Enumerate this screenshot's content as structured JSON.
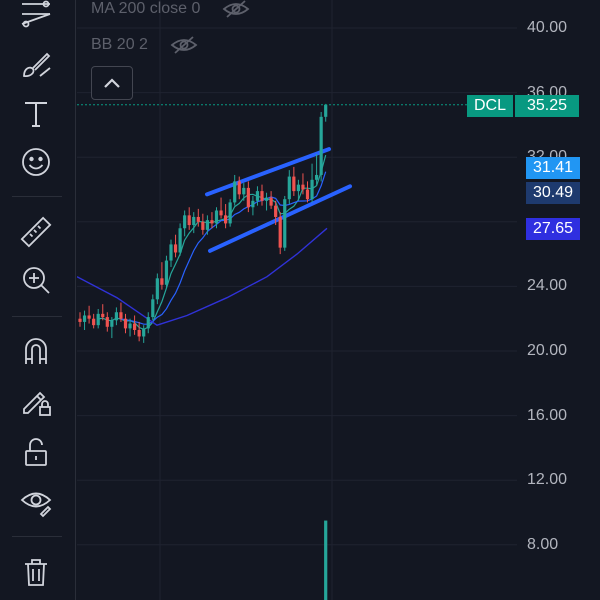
{
  "indicators": [
    {
      "label": "MA 200 close 0",
      "icon": "eye-crossed-icon"
    },
    {
      "label": "BB 20 2",
      "icon": "eye-crossed-icon"
    }
  ],
  "toolbar": {
    "tools": [
      "trend-line-icon",
      "brush-icon",
      "text-icon",
      "emoji-icon",
      "ruler-icon",
      "zoom-in-icon",
      "magnet-icon",
      "lock-drawing-icon",
      "unlock-icon",
      "eye-visibility-icon",
      "trash-icon"
    ]
  },
  "price_axis": {
    "ticks": [
      "40.00",
      "36.00",
      "32.00",
      "24.00",
      "20.00",
      "16.00",
      "12.00",
      "8.00"
    ]
  },
  "price_tags": {
    "symbol": "DCL",
    "last": "35.25",
    "tag1": "31.41",
    "tag2": "30.49",
    "tag3": "27.65"
  },
  "colors": {
    "background": "#131722",
    "up": "#26a69a",
    "down": "#ef5350",
    "channel": "#2962ff",
    "ma": "#3032d8",
    "tag_light_blue": "#2196f3",
    "tag_indigo": "#2f2fe0",
    "tag_green": "#089981"
  },
  "chart_data": {
    "type": "candlestick",
    "ylim": [
      6,
      42
    ],
    "y_ticks": [
      40,
      36,
      32,
      24,
      20,
      16,
      12,
      8
    ],
    "last_price": 35.25,
    "candles": [
      [
        22.0,
        22.4,
        21.5,
        21.8
      ],
      [
        21.8,
        22.5,
        21.3,
        22.2
      ],
      [
        22.2,
        22.8,
        21.7,
        22.0
      ],
      [
        22.0,
        22.3,
        21.4,
        21.6
      ],
      [
        21.6,
        22.6,
        21.4,
        22.3
      ],
      [
        22.3,
        22.9,
        21.9,
        22.1
      ],
      [
        22.1,
        22.4,
        21.2,
        21.5
      ],
      [
        21.5,
        22.1,
        20.8,
        21.9
      ],
      [
        21.9,
        22.7,
        21.6,
        22.4
      ],
      [
        22.4,
        23.0,
        21.8,
        22.0
      ],
      [
        22.0,
        22.3,
        21.1,
        21.4
      ],
      [
        21.4,
        22.0,
        20.9,
        21.7
      ],
      [
        21.7,
        22.2,
        21.0,
        21.3
      ],
      [
        21.3,
        21.8,
        20.6,
        20.9
      ],
      [
        20.9,
        21.6,
        20.5,
        21.4
      ],
      [
        21.4,
        22.4,
        21.1,
        22.1
      ],
      [
        22.1,
        23.5,
        21.9,
        23.2
      ],
      [
        23.2,
        24.8,
        22.9,
        24.5
      ],
      [
        24.5,
        25.5,
        23.8,
        24.1
      ],
      [
        24.1,
        25.9,
        23.9,
        25.6
      ],
      [
        25.6,
        26.9,
        25.2,
        26.6
      ],
      [
        26.6,
        27.2,
        25.8,
        26.1
      ],
      [
        26.1,
        27.9,
        25.9,
        27.6
      ],
      [
        27.6,
        28.7,
        27.1,
        28.4
      ],
      [
        28.4,
        28.9,
        27.5,
        27.8
      ],
      [
        27.8,
        28.6,
        27.3,
        28.3
      ],
      [
        28.3,
        28.8,
        27.7,
        28.0
      ],
      [
        28.0,
        28.5,
        27.2,
        27.5
      ],
      [
        27.5,
        28.4,
        27.2,
        28.1
      ],
      [
        28.1,
        28.6,
        27.6,
        27.9
      ],
      [
        27.9,
        28.9,
        27.6,
        28.7
      ],
      [
        28.7,
        29.5,
        28.2,
        28.4
      ],
      [
        28.4,
        29.1,
        27.6,
        27.9
      ],
      [
        27.9,
        29.4,
        27.7,
        29.2
      ],
      [
        29.2,
        30.9,
        29.0,
        30.5
      ],
      [
        30.5,
        30.8,
        29.4,
        29.7
      ],
      [
        29.7,
        30.4,
        29.3,
        30.1
      ],
      [
        30.1,
        30.5,
        28.6,
        28.9
      ],
      [
        28.9,
        29.6,
        28.4,
        29.3
      ],
      [
        29.3,
        30.2,
        29.0,
        29.9
      ],
      [
        29.9,
        30.3,
        29.0,
        29.3
      ],
      [
        29.3,
        29.8,
        28.7,
        29.5
      ],
      [
        29.5,
        29.9,
        28.8,
        29.0
      ],
      [
        29.0,
        29.3,
        27.8,
        28.3
      ],
      [
        28.3,
        28.6,
        26.0,
        26.4
      ],
      [
        26.4,
        29.6,
        26.2,
        29.4
      ],
      [
        29.4,
        31.2,
        29.1,
        30.8
      ],
      [
        30.8,
        31.4,
        29.6,
        29.9
      ],
      [
        29.9,
        30.6,
        29.3,
        30.3
      ],
      [
        30.3,
        31.0,
        29.7,
        30.0
      ],
      [
        30.0,
        30.5,
        29.2,
        29.4
      ],
      [
        29.4,
        31.6,
        29.2,
        30.6
      ],
      [
        30.6,
        32.2,
        30.3,
        30.9
      ],
      [
        30.9,
        34.8,
        30.5,
        34.5
      ],
      [
        34.5,
        35.3,
        34.2,
        35.25
      ]
    ],
    "volume_bar": {
      "price_top": 9.5
    }
  }
}
